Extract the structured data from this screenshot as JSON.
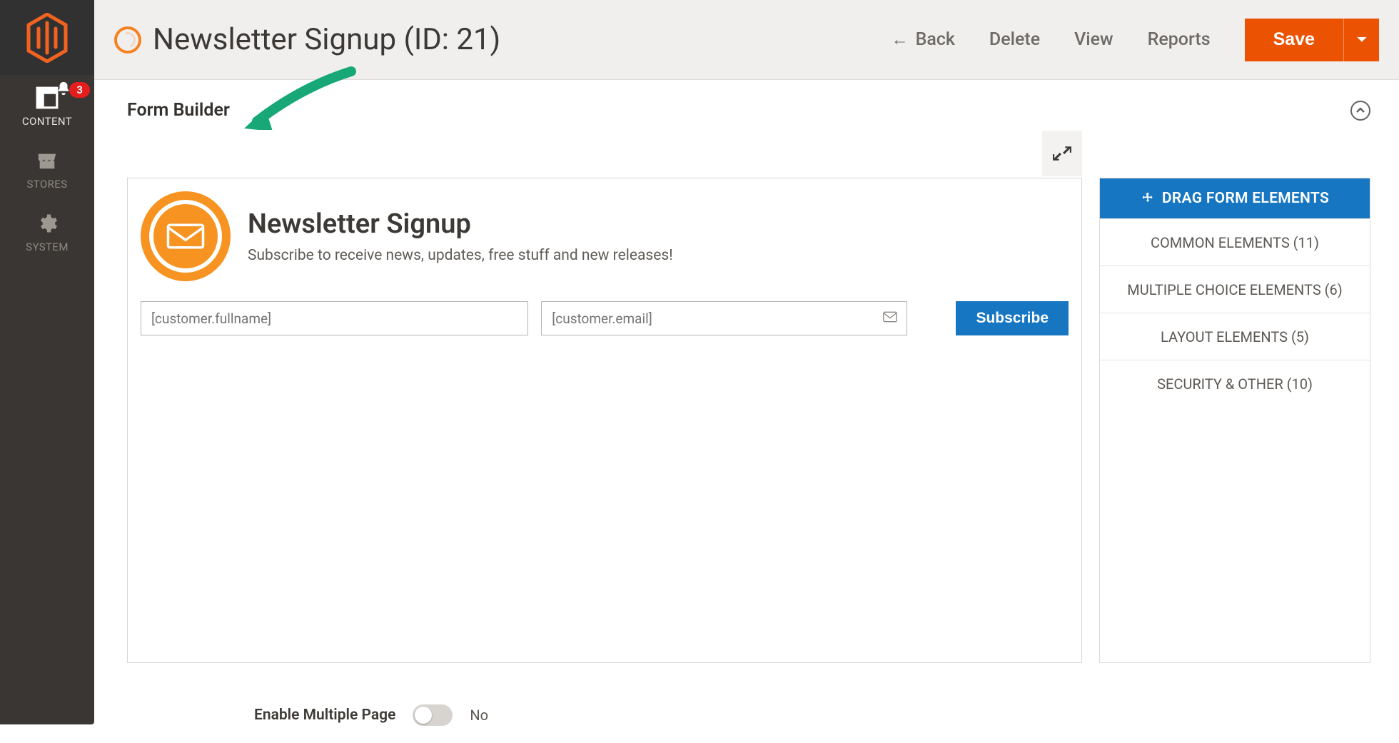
{
  "sidebar": {
    "items": [
      {
        "label": "CONTENT"
      },
      {
        "label": "STORES"
      },
      {
        "label": "SYSTEM"
      }
    ],
    "notification_count": "3"
  },
  "header": {
    "title": "Newsletter Signup (ID: 21)",
    "back": "Back",
    "delete": "Delete",
    "view": "View",
    "reports": "Reports",
    "save": "Save"
  },
  "section": {
    "title": "Form Builder"
  },
  "form": {
    "title": "Newsletter Signup",
    "subtitle": "Subscribe to receive news, updates, free stuff and new releases!",
    "fullname_placeholder": "[customer.fullname]",
    "email_placeholder": "[customer.email]",
    "subscribe_label": "Subscribe"
  },
  "palette": {
    "heading": "DRAG FORM ELEMENTS",
    "groups": [
      "COMMON ELEMENTS (11)",
      "MULTIPLE CHOICE ELEMENTS (6)",
      "LAYOUT ELEMENTS (5)",
      "SECURITY & OTHER (10)"
    ]
  },
  "toggle": {
    "label": "Enable Multiple Page",
    "value": "No"
  }
}
